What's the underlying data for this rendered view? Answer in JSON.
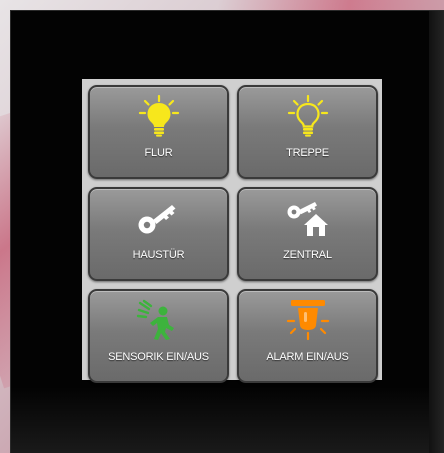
{
  "panel": {
    "tiles": [
      {
        "label": "FLUR",
        "icon": "lightbulb-on-icon",
        "icon_color": "#f7e71c"
      },
      {
        "label": "TREPPE",
        "icon": "lightbulb-outline-icon",
        "icon_color": "#f7e71c"
      },
      {
        "label": "HAUSTÜR",
        "icon": "key-icon",
        "icon_color": "#ffffff"
      },
      {
        "label": "ZENTRAL",
        "icon": "key-house-icon",
        "icon_color": "#ffffff"
      },
      {
        "label": "SENSORIK EIN/AUS",
        "icon": "motion-sensor-icon",
        "icon_color": "#3db33d"
      },
      {
        "label": "ALARM EIN/AUS",
        "icon": "alarm-siren-icon",
        "icon_color": "#ff8a00"
      }
    ]
  }
}
